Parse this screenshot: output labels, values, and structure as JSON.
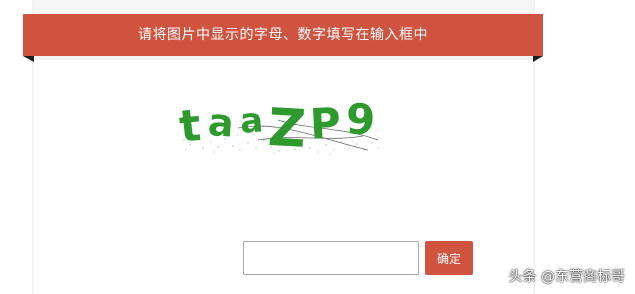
{
  "header": {
    "title": "请将图片中显示的字母、数字填写在输入框中"
  },
  "captcha": {
    "text": "taaZP9",
    "color": "#2e9a2e"
  },
  "form": {
    "input_value": "",
    "input_placeholder": "",
    "confirm_label": "确定"
  },
  "watermark": {
    "text": "头条 @东营商标哥"
  },
  "colors": {
    "accent": "#cf533f",
    "ribbon_fold": "#1c1c1c"
  }
}
